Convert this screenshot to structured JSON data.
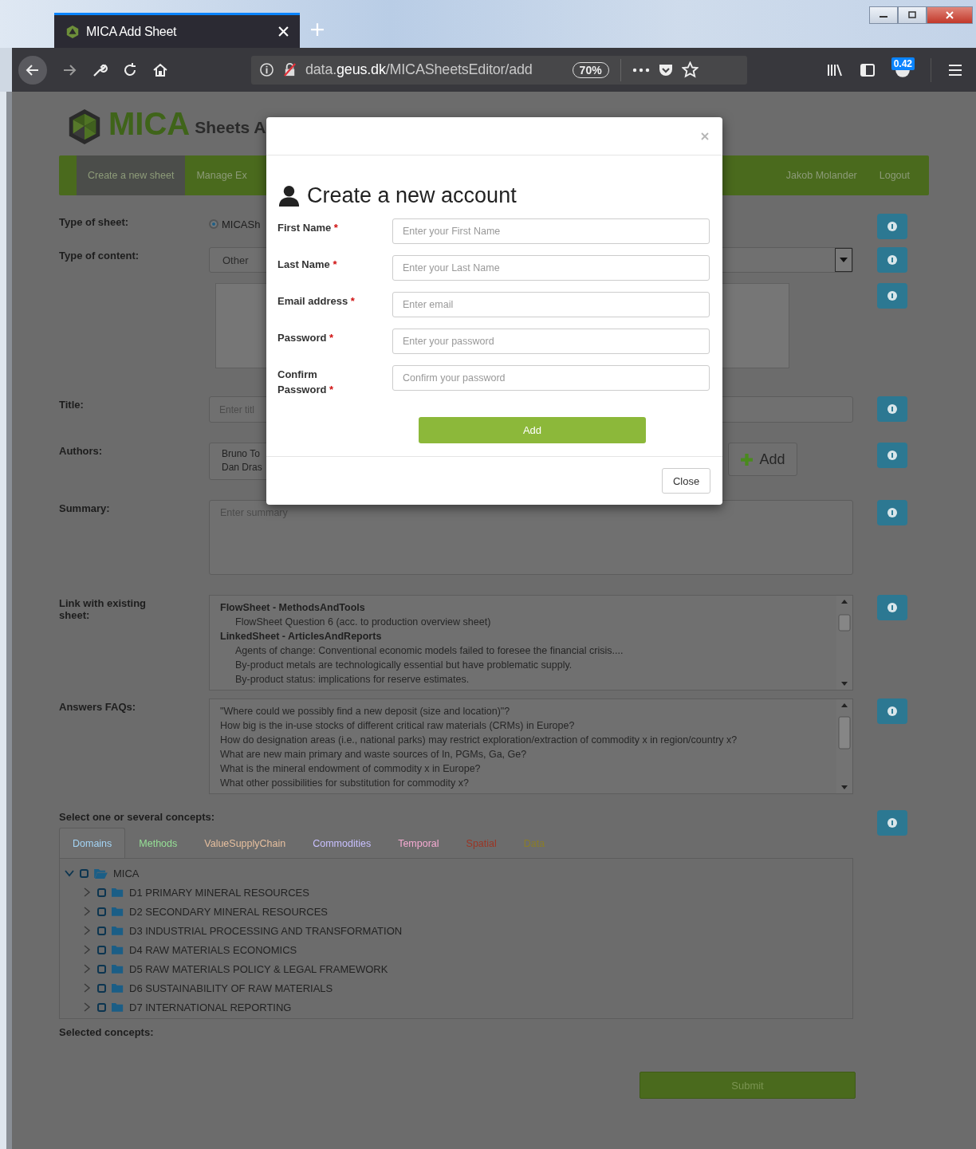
{
  "browser": {
    "tab_title": "MICA Add Sheet",
    "url": "data.**geus.dk**/MICASheetsEditor/add",
    "zoom": "70%",
    "badge": "0.42"
  },
  "site": {
    "logo": "MICA",
    "subtitle": "Sheets A"
  },
  "nav": {
    "items": [
      {
        "label": "Create a new sheet",
        "selected": true
      },
      {
        "label": "Manage Ex",
        "selected": false
      }
    ],
    "user": "Jakob Molander",
    "logout": "Logout"
  },
  "form": {
    "type_of_sheet": {
      "label": "Type of sheet:",
      "option": "MICASh",
      "checked": true
    },
    "type_of_content": {
      "label": "Type of content:",
      "value": "Other"
    },
    "title": {
      "label": "Title:",
      "placeholder": "Enter titl"
    },
    "authors": {
      "label": "Authors:",
      "items": [
        "Bruno To",
        "Dan Dras"
      ],
      "add": "Add"
    },
    "summary": {
      "label": "Summary:",
      "placeholder": "Enter summary"
    },
    "link": {
      "label": "Link with existing sheet:",
      "groups": [
        {
          "name": "FlowSheet - MethodsAndTools",
          "items": [
            "FlowSheet Question 6 (acc. to production overview sheet)"
          ]
        },
        {
          "name": "LinkedSheet - ArticlesAndReports",
          "items": [
            "Agents of change: Conventional economic models failed to foresee the financial crisis....",
            "By-product metals are technologically essential but have problematic supply.",
            "By-product status: implications for reserve estimates."
          ]
        }
      ]
    },
    "faqs": {
      "label": "Answers FAQs:",
      "items": [
        "\"Where could we possibly find a new deposit (size and location)\"?",
        "How big is the in-use stocks of different critical raw materials (CRMs) in Europe?",
        "How do designation areas (i.e., national parks) may restrict exploration/extraction of commodity x in region/country x?",
        "What are new main primary and waste sources of In, PGMs, Ga, Ge?",
        "What is the mineral endowment of commodity x in Europe?",
        "What other possibilities for substitution for commodity x?"
      ]
    },
    "concepts": {
      "label": "Select one or several concepts:",
      "tabs": [
        {
          "label": "Domains",
          "selected": true,
          "color": "#a3d4f5"
        },
        {
          "label": "Methods",
          "selected": false,
          "color": "#96e096"
        },
        {
          "label": "ValueSupplyChain",
          "selected": false,
          "color": "#e6bf9e"
        },
        {
          "label": "Commodities",
          "selected": false,
          "color": "#c8c0ff"
        },
        {
          "label": "Temporal",
          "selected": false,
          "color": "#f5aad2"
        },
        {
          "label": "Spatial",
          "selected": false,
          "color": "#9b3524"
        },
        {
          "label": "Data",
          "selected": false,
          "color": "#8a7d27"
        }
      ],
      "tree": {
        "label": "MICA",
        "expanded": true,
        "checked": false,
        "children": [
          {
            "label": "D1 PRIMARY MINERAL RESOURCES",
            "expanded": false,
            "checked": false
          },
          {
            "label": "D2 SECONDARY MINERAL RESOURCES",
            "expanded": false,
            "checked": false
          },
          {
            "label": "D3 INDUSTRIAL PROCESSING AND TRANSFORMATION",
            "expanded": false,
            "checked": false
          },
          {
            "label": "D4 RAW MATERIALS ECONOMICS",
            "expanded": false,
            "checked": false
          },
          {
            "label": "D5 RAW MATERIALS POLICY & LEGAL FRAMEWORK",
            "expanded": false,
            "checked": false
          },
          {
            "label": "D6 SUSTAINABILITY OF RAW MATERIALS",
            "expanded": false,
            "checked": false
          },
          {
            "label": "D7 INTERNATIONAL REPORTING",
            "expanded": false,
            "checked": false
          }
        ]
      },
      "selected_label": "Selected concepts:"
    },
    "submit": "Submit"
  },
  "modal": {
    "title": "Create a new account",
    "fields": [
      {
        "label": "First Name",
        "mark": "*",
        "placeholder": "Enter your First Name"
      },
      {
        "label": "Last Name",
        "mark": "*",
        "placeholder": "Enter your Last Name"
      },
      {
        "label": "Email address",
        "mark": "*",
        "placeholder": "Enter email"
      },
      {
        "label": "Password",
        "mark": "*",
        "placeholder": "Enter your password"
      },
      {
        "label": "Confirm Password",
        "mark": "*",
        "placeholder": "Confirm your password"
      }
    ],
    "add": "Add",
    "close": "Close"
  }
}
